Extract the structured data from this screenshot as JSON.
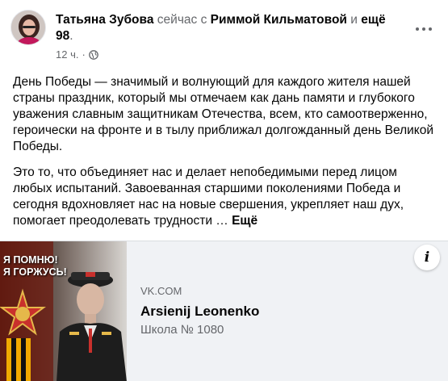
{
  "post": {
    "author": "Татьяна Зубова",
    "status_word": "сейчас с",
    "tagged_person": "Риммой Кильматовой",
    "conjunction": "и",
    "tagged_more": "ещё 98",
    "period": ".",
    "timestamp": "12 ч.",
    "separator": "·",
    "privacy_icon": "globe-icon",
    "more_icon": "more-horizontal-icon",
    "paragraphs": [
      "День Победы — значимый и волнующий для каждого жителя нашей страны праздник, который мы отмечаем как дань памяти и глубокого уважения славным защитникам Отечества, всем, кто самоотверженно, героически на фронте и в тылу приближал долгожданный день Великой Победы.",
      "Это то, что объединяет нас и делает непобедимыми перед лицом любых испытаний. Завоеванная старшими поколениями Победа и сегодня вдохновляет нас на новые свершения, укрепляет наш дух, помогает преодолевать трудности …"
    ],
    "see_more": "Ещё"
  },
  "link_card": {
    "image_caption_line1": "Я ПОМНЮ!",
    "image_caption_line2": "Я ГОРЖУСЬ!",
    "domain": "VK.COM",
    "title": "Arsienij Leonenko",
    "description": "Школа № 1080",
    "info_label": "i"
  },
  "colors": {
    "text_primary": "#050505",
    "text_secondary": "#65676b",
    "card_background": "#f0f2f5"
  }
}
